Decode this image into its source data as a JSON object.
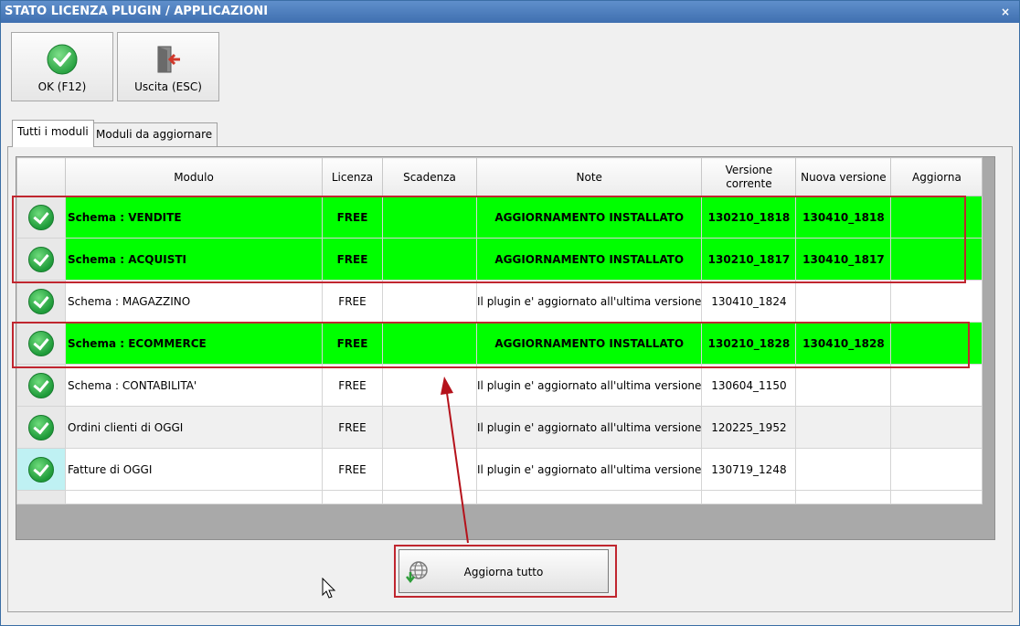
{
  "window": {
    "title": "STATO LICENZA PLUGIN / APPLICAZIONI",
    "close_glyph": "×"
  },
  "toolbar": {
    "ok_label": "OK (F12)",
    "ok_icon": "check-circle-icon",
    "exit_label": "Uscita (ESC)",
    "exit_icon": "exit-door-icon"
  },
  "tabs": [
    {
      "label": "Tutti i moduli",
      "active": true
    },
    {
      "label": "Moduli da aggiornare",
      "active": false
    }
  ],
  "grid": {
    "columns": [
      "Modulo",
      "Licenza",
      "Scadenza",
      "Note",
      "Versione corrente",
      "Nuova versione",
      "Aggiorna"
    ],
    "rows": [
      {
        "modulo": "Schema : VENDITE",
        "licenza": "FREE",
        "scadenza": "",
        "note": "AGGIORNAMENTO INSTALLATO",
        "versione": "130210_1818",
        "nuova": "130410_1818",
        "aggiorna": "",
        "status": "ok",
        "highlight": true
      },
      {
        "modulo": "Schema : ACQUISTI",
        "licenza": "FREE",
        "scadenza": "",
        "note": "AGGIORNAMENTO INSTALLATO",
        "versione": "130210_1817",
        "nuova": "130410_1817",
        "aggiorna": "",
        "status": "ok",
        "highlight": true
      },
      {
        "modulo": "Schema : MAGAZZINO",
        "licenza": "FREE",
        "scadenza": "",
        "note": "Il plugin e' aggiornato all'ultima versione",
        "versione": "130410_1824",
        "nuova": "",
        "aggiorna": "",
        "status": "ok",
        "highlight": false
      },
      {
        "modulo": "Schema : ECOMMERCE",
        "licenza": "FREE",
        "scadenza": "",
        "note": "AGGIORNAMENTO INSTALLATO",
        "versione": "130210_1828",
        "nuova": "130410_1828",
        "aggiorna": "",
        "status": "ok",
        "highlight": true
      },
      {
        "modulo": "Schema : CONTABILITA'",
        "licenza": "FREE",
        "scadenza": "",
        "note": "Il plugin e' aggiornato all'ultima versione",
        "versione": "130604_1150",
        "nuova": "",
        "aggiorna": "",
        "status": "ok",
        "highlight": false
      },
      {
        "modulo": "Ordini clienti di OGGI",
        "licenza": "FREE",
        "scadenza": "",
        "note": "Il plugin e' aggiornato all'ultima versione",
        "versione": "120225_1952",
        "nuova": "",
        "aggiorna": "",
        "status": "ok",
        "highlight": false
      },
      {
        "modulo": "Fatture di OGGI",
        "licenza": "FREE",
        "scadenza": "",
        "note": "Il plugin e' aggiornato all'ultima versione",
        "versione": "130719_1248",
        "nuova": "",
        "aggiorna": "",
        "status": "ok",
        "highlight": false
      }
    ]
  },
  "update_all": {
    "label": "Aggiorna tutto",
    "icon": "globe-download-icon"
  },
  "colors": {
    "highlight_row": "#00ff00",
    "annotation": "#c0262f",
    "titlebar": "#4a7bbd"
  }
}
